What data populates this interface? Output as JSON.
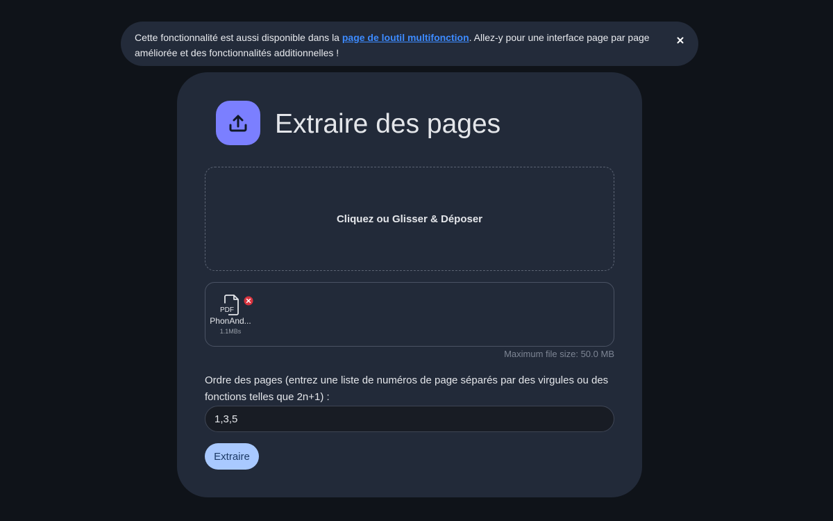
{
  "banner": {
    "text_before": "Cette fonctionnalité est aussi disponible dans la ",
    "link_text": "page de loutil multifonction",
    "text_after": ". Allez-y pour une interface page par page améliorée et des fonctionnalités additionnelles !",
    "close_label": "×"
  },
  "tool": {
    "title": "Extraire des pages",
    "icon": "upload-icon",
    "icon_color": "#7b7fff"
  },
  "dropzone": {
    "label": "Cliquez ou Glisser & Déposer"
  },
  "files": [
    {
      "type_label": "PDF",
      "name": "PhonAnd...",
      "size": "1.1MBs",
      "icon": "pdf-file-icon",
      "remove_icon": "remove-icon"
    }
  ],
  "max_file_size": "Maximum file size: 50.0 MB",
  "page_order": {
    "label": "Ordre des pages (entrez une liste de numéros de page séparés par des virgules ou des fonctions telles que 2n+1) :",
    "value": "1,3,5"
  },
  "submit": {
    "label": "Extraire"
  },
  "colors": {
    "background": "#0f1319",
    "card": "#222a39",
    "link": "#3d8bff",
    "button": "#a9c9ff",
    "remove": "#d9343f"
  }
}
